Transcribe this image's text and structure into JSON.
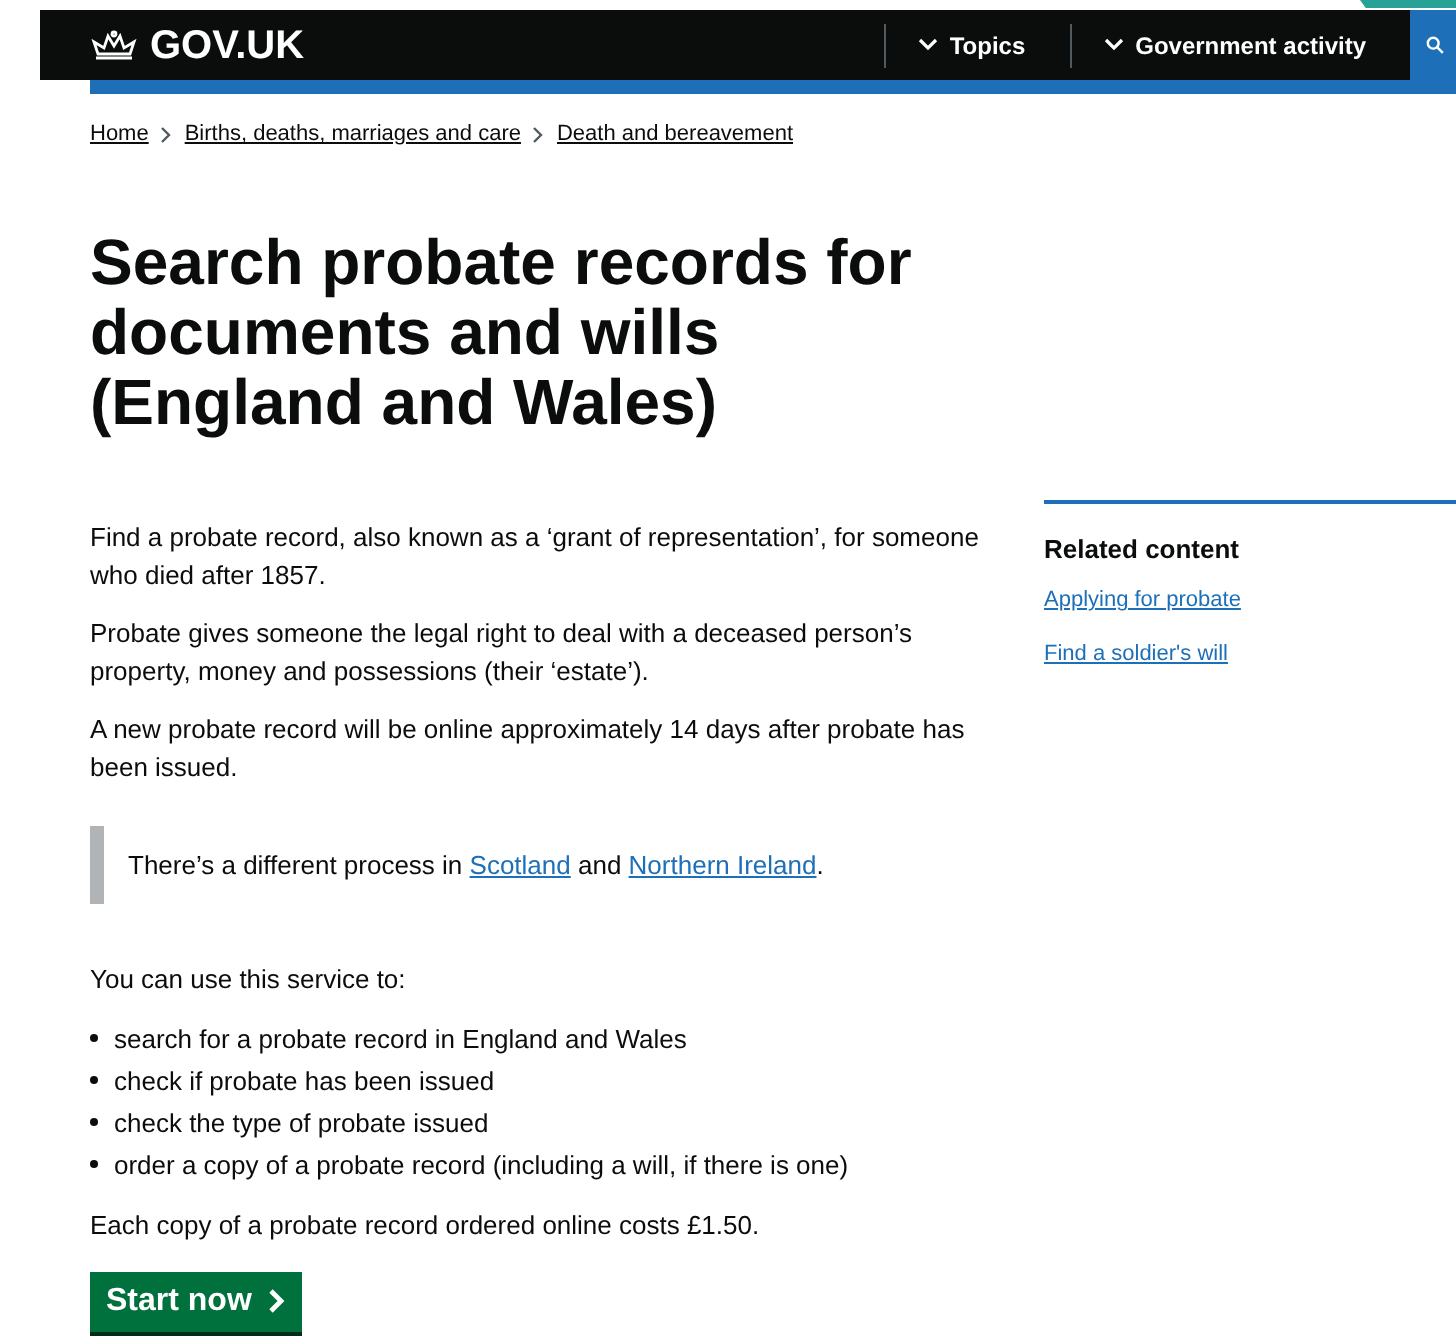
{
  "header": {
    "logo": "GOV.UK",
    "nav": [
      {
        "label": "Topics",
        "expanded": false
      },
      {
        "label": "Government activity",
        "expanded": false
      }
    ]
  },
  "breadcrumbs": [
    "Home",
    "Births, deaths, marriages and care",
    "Death and bereavement"
  ],
  "title": "Search probate records for documents and wills (England and Wales)",
  "intro": [
    "Find a probate record, also known as a ‘grant of representation’, for someone who died after 1857.",
    "Probate gives someone the legal right to deal with a deceased person’s property, money and possessions (their ‘estate’).",
    "A new probate record will be online approximately 14 days after probate has been issued."
  ],
  "inset": [
    {
      "kind": "text",
      "text": "There’s a different process in "
    },
    {
      "kind": "link",
      "text": "Scotland"
    },
    {
      "kind": "text",
      "text": " and "
    },
    {
      "kind": "link",
      "text": "Northern Ireland"
    },
    {
      "kind": "text",
      "text": "."
    }
  ],
  "list_intro": "You can use this service to:",
  "list": [
    "search for a probate record in England and Wales",
    "check if probate has been issued",
    "check the type of probate issued",
    "order a copy of a probate record (including a will, if there is one)"
  ],
  "cost": "Each copy of a probate record ordered online costs £1.50.",
  "start_button": "Start now",
  "related": {
    "title": "Related content",
    "links": [
      "Applying for probate",
      "Find a soldier's will"
    ]
  }
}
